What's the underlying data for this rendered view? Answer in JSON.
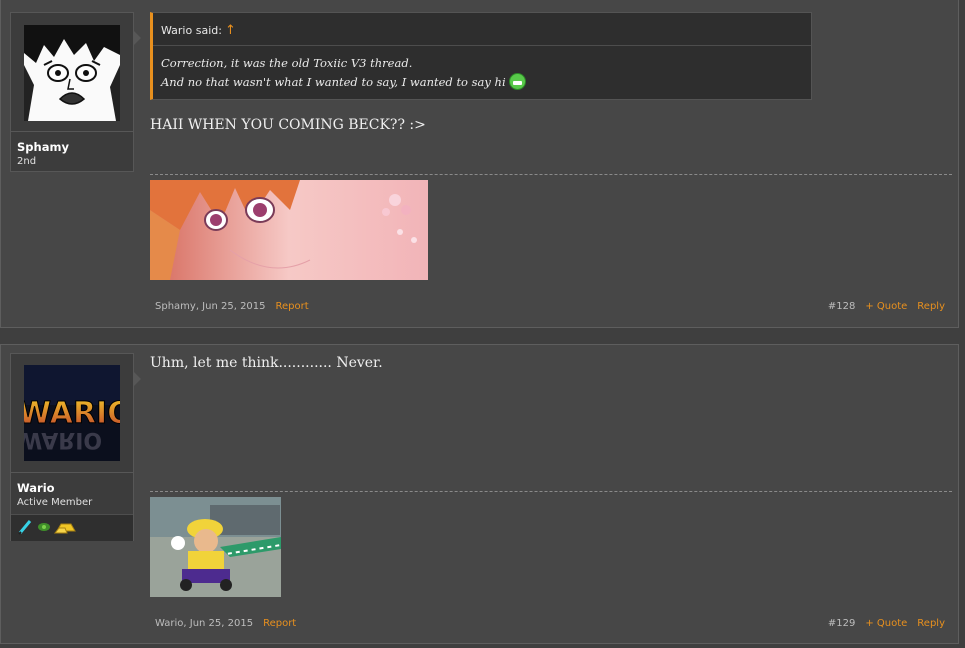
{
  "posts": [
    {
      "user": {
        "name": "Sphamy",
        "title": "2nd"
      },
      "quote": {
        "author_label": "Wario said:",
        "up_icon": "↑",
        "lines": [
          "Correction, it was the old Toxiic V3 thread.",
          "And no that wasn't what I wanted to say, I wanted to say hi"
        ]
      },
      "message": "HAII WHEN YOU COMING BECK?? :>",
      "meta": {
        "author_date": "Sphamy, Jun 25, 2015",
        "report": "Report"
      },
      "actions": {
        "number": "#128",
        "quote": "+ Quote",
        "reply": "Reply"
      }
    },
    {
      "user": {
        "name": "Wario",
        "title": "Active Member",
        "avatar_text": "WARIO"
      },
      "message": "Uhm, let me think............ Never.",
      "meta": {
        "author_date": "Wario, Jun 25, 2015",
        "report": "Report"
      },
      "actions": {
        "number": "#129",
        "quote": "+ Quote",
        "reply": "Reply"
      }
    }
  ],
  "colors": {
    "accent": "#e8901e",
    "background": "#474747"
  }
}
